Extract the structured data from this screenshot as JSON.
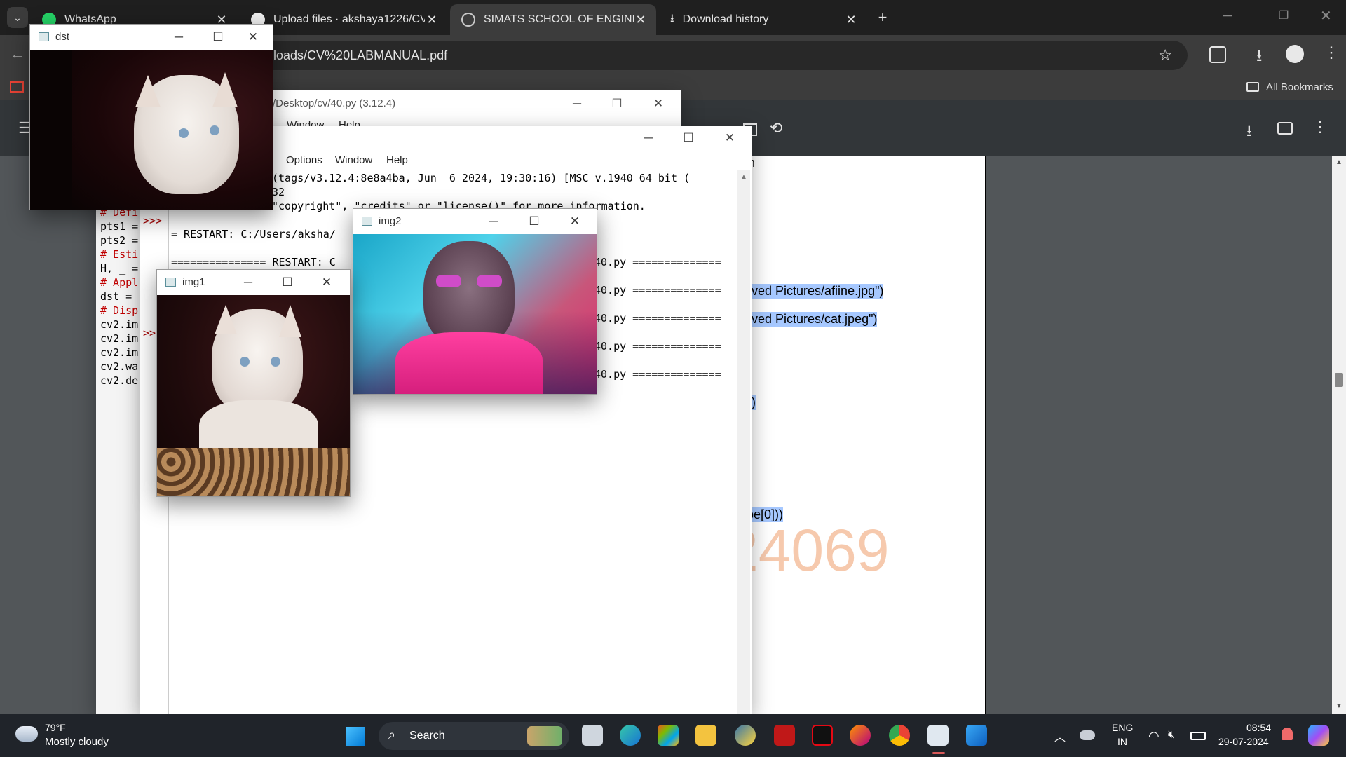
{
  "browser": {
    "tabs": [
      {
        "title": "WhatsApp",
        "active": false
      },
      {
        "title": "Upload files · akshaya1226/CV",
        "active": false
      },
      {
        "title": "SIMATS SCHOOL OF ENGINEERI",
        "active": true
      },
      {
        "title": "Download history",
        "active": false
      }
    ],
    "new_tab_symbol": "+",
    "url": "nloads/CV%20LABMANUAL.pdf",
    "bookmarks_label": "All Bookmarks"
  },
  "pdf": {
    "lines": [
      "ved Pictures/afiine.jpg\")",
      "ved Pictures/cat.jpeg\")",
      ")",
      "pe[0]))"
    ],
    "watermark": "24069",
    "top_fragment": "n"
  },
  "idle_back": {
    "title": "/Desktop/cv/40.py (3.12.4)",
    "menu": [
      "Window",
      "Help"
    ],
    "code_lines": [
      "# Defi",
      "pts1 =",
      "pts2 =",
      "# Esti",
      "H, _ =",
      "# Appl",
      "dst =",
      "# Disp",
      "cv2.im",
      "cv2.im",
      "cv2.im",
      "cv2.wa",
      "cv2.de"
    ]
  },
  "idle_shell": {
    "menu": [
      "Options",
      "Window",
      "Help"
    ],
    "lines": [
      "(tags/v3.12.4:8e8a4ba, Jun  6 2024, 19:30:16) [MSC v.1940 64 bit (",
      "32",
      "\"copyright\", \"credits\" or \"license()\" for more information.",
      "= RESTART: C:/Users/aksha/",
      "=============== RESTART: C",
      "40.py ==============",
      "40.py ==============",
      "40.py ==============",
      "40.py ==============",
      "40.py =============="
    ],
    "prompt": ">>>",
    "prompt_partial": ">>"
  },
  "image_windows": {
    "dst": {
      "title": "dst"
    },
    "img1": {
      "title": "img1"
    },
    "img2": {
      "title": "img2"
    }
  },
  "taskbar": {
    "weather_temp": "79°F",
    "weather_desc": "Mostly cloudy",
    "search_label": "Search",
    "lang_top": "ENG",
    "lang_bottom": "IN",
    "time": "08:54",
    "date": "29-07-2024"
  }
}
